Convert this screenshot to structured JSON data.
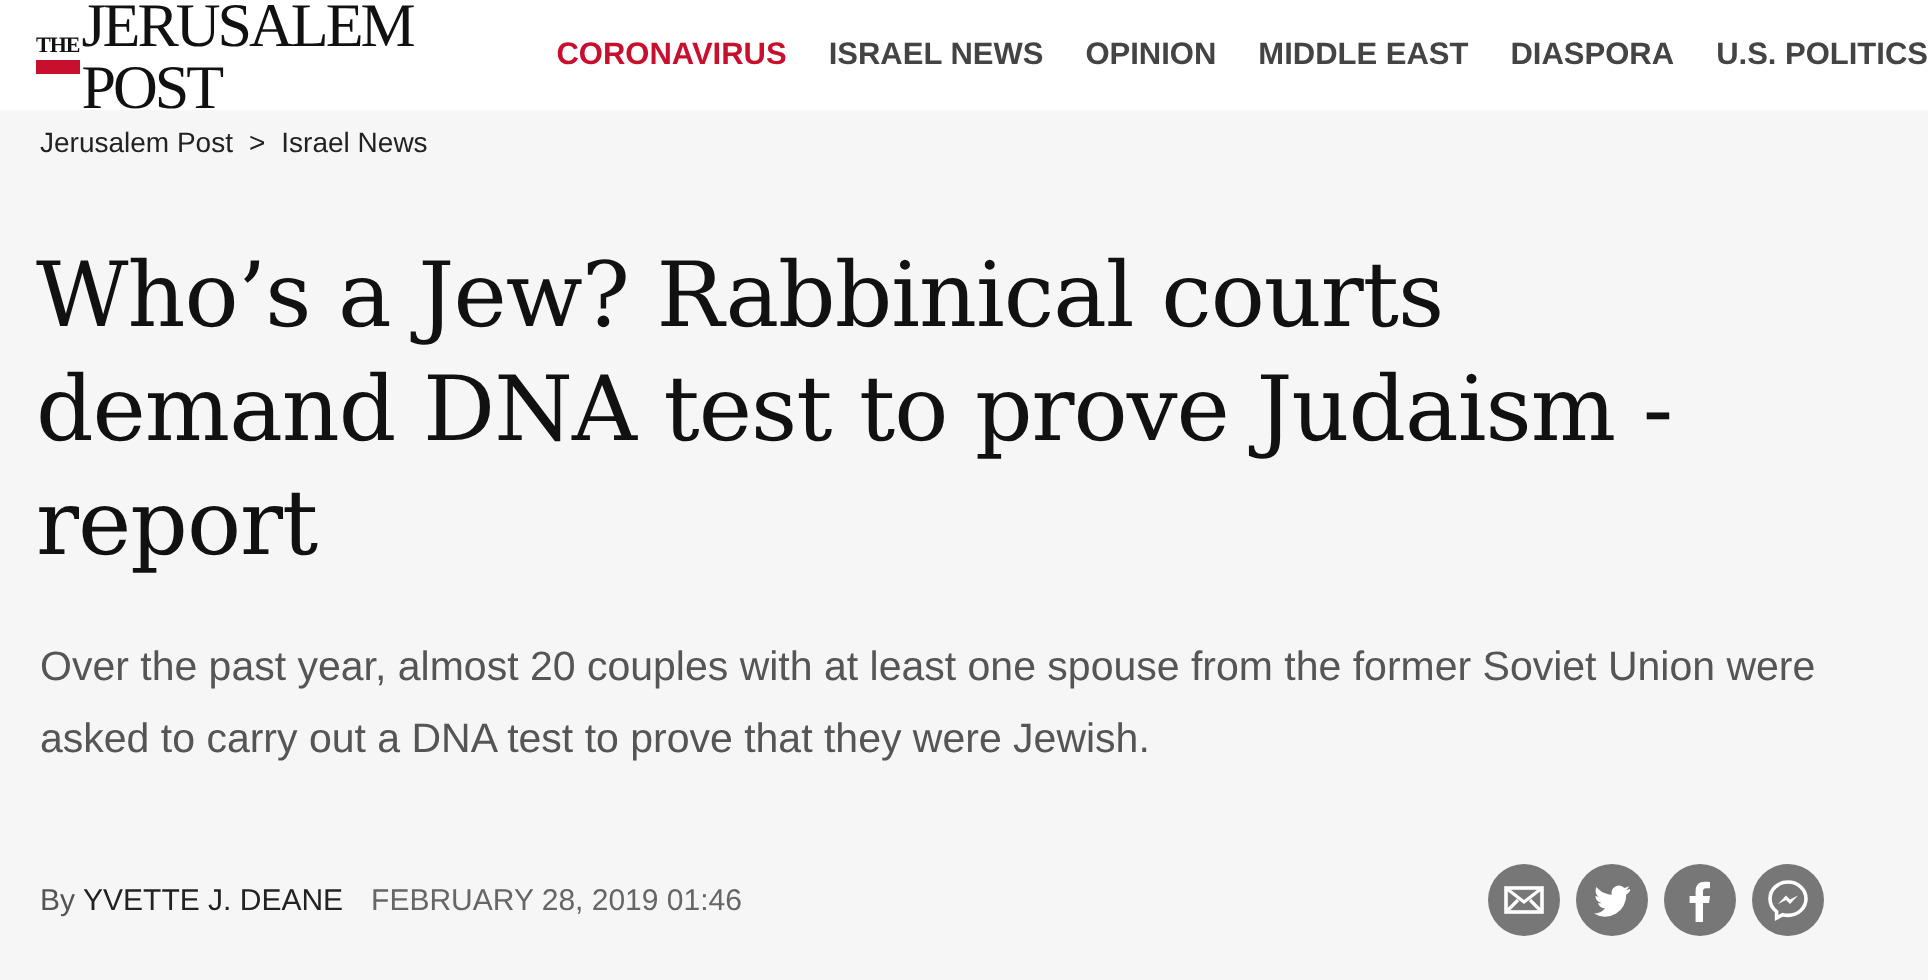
{
  "logo": {
    "prefix": "THE",
    "name": "JERUSALEM POST"
  },
  "nav": [
    {
      "label": "CORONAVIRUS",
      "selected": true
    },
    {
      "label": "ISRAEL NEWS",
      "selected": false
    },
    {
      "label": "OPINION",
      "selected": false
    },
    {
      "label": "MIDDLE EAST",
      "selected": false
    },
    {
      "label": "DIASPORA",
      "selected": false
    },
    {
      "label": "U.S. POLITICS",
      "selected": false
    }
  ],
  "breadcrumb": {
    "items": [
      "Jerusalem Post",
      "Israel News"
    ],
    "separator": ">"
  },
  "article": {
    "title": "Who’s a Jew? Rabbinical courts demand DNA test to prove Judaism - report",
    "summary": "Over the past year, almost 20 couples with at least one spouse from the former Soviet Union were asked to carry out a DNA test to prove that they were Jewish.",
    "byline_prefix": "By",
    "author": "YVETTE J. DEANE",
    "date": "FEBRUARY 28, 2019 01:46"
  },
  "share": [
    {
      "kind": "email"
    },
    {
      "kind": "twitter"
    },
    {
      "kind": "facebook"
    },
    {
      "kind": "messenger"
    }
  ]
}
